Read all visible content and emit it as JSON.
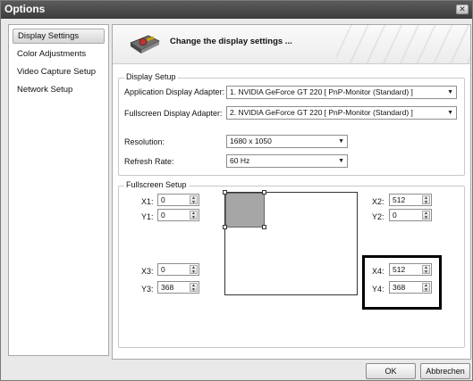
{
  "window": {
    "title": "Options"
  },
  "sidebar": {
    "items": [
      {
        "label": "Display Settings"
      },
      {
        "label": "Color Adjustments"
      },
      {
        "label": "Video Capture Setup"
      },
      {
        "label": "Network Setup"
      }
    ]
  },
  "header": {
    "title": "Change the display settings ..."
  },
  "display_setup": {
    "legend": "Display Setup",
    "app_adapter_label": "Application Display Adapter:",
    "app_adapter_value": "1. NVIDIA GeForce GT 220 [ PnP-Monitor (Standard) ]",
    "fs_adapter_label": "Fullscreen Display Adapter:",
    "fs_adapter_value": "2. NVIDIA GeForce GT 220 [ PnP-Monitor (Standard) ]",
    "resolution_label": "Resolution:",
    "resolution_value": "1680 x 1050",
    "refresh_label": "Refresh Rate:",
    "refresh_value": "60 Hz"
  },
  "fullscreen_setup": {
    "legend": "Fullscreen Setup",
    "x1_label": "X1:",
    "x1_value": "0",
    "y1_label": "Y1:",
    "y1_value": "0",
    "x2_label": "X2:",
    "x2_value": "512",
    "y2_label": "Y2:",
    "y2_value": "0",
    "x3_label": "X3:",
    "x3_value": "0",
    "y3_label": "Y3:",
    "y3_value": "368",
    "x4_label": "X4:",
    "x4_value": "512",
    "y4_label": "Y4:",
    "y4_value": "368"
  },
  "footer": {
    "ok_label": "OK",
    "cancel_label": "Abbrechen"
  },
  "icons": {
    "close": "close-icon",
    "gpu": "graphics-card-icon",
    "dropdown": "chevron-down-icon",
    "spin": "spin-arrows-icon"
  },
  "colors": {
    "titlebar": "#4a4a4a",
    "selection": "#a6a6a6",
    "window_bg": "#e9e9e9"
  }
}
